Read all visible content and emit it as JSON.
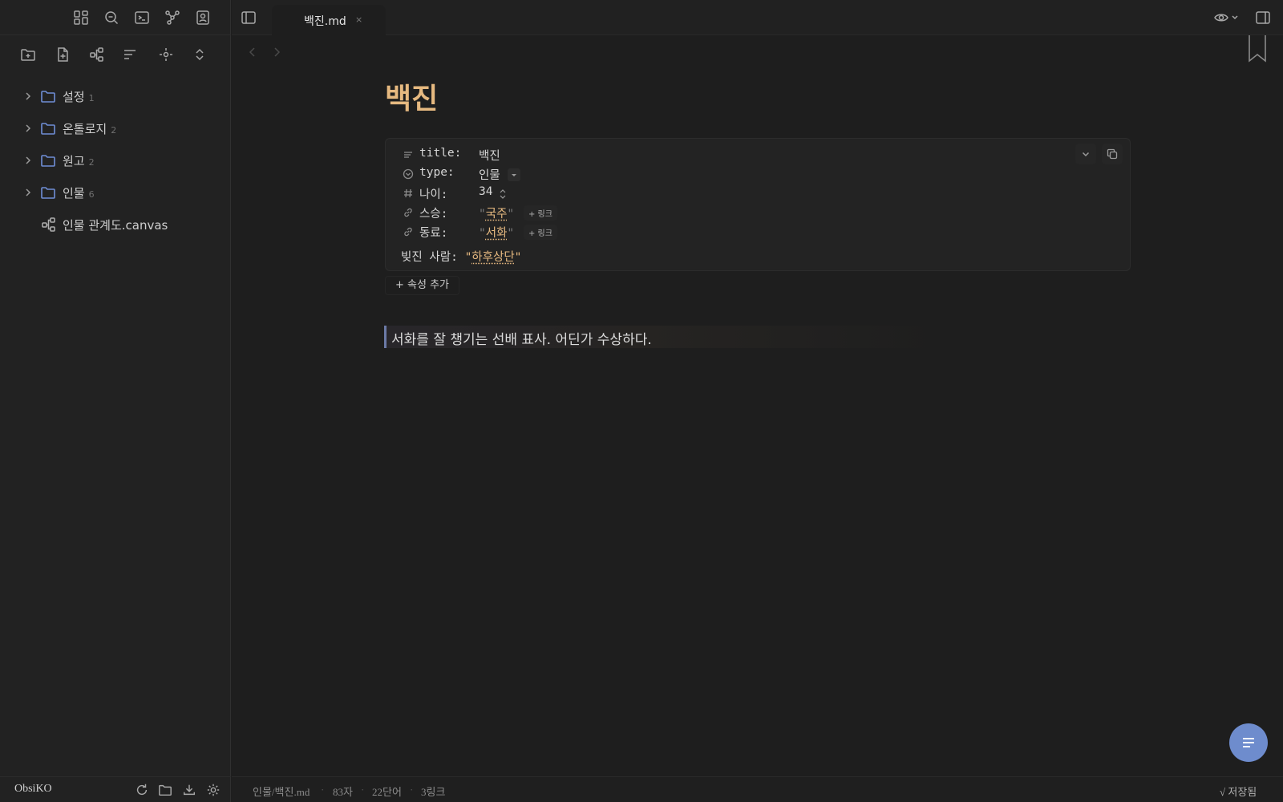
{
  "sidebar": {
    "ribbon_icons": [
      "dashboard-icon",
      "search-icon",
      "terminal-icon",
      "graph-icon",
      "contact-icon"
    ],
    "toolbar_icons": [
      "new-folder-icon",
      "new-note-icon",
      "new-canvas-icon",
      "sort-icon",
      "reveal-icon",
      "collapse-icon"
    ],
    "tree": [
      {
        "name": "설정",
        "count": "1",
        "type": "folder"
      },
      {
        "name": "온톨로지",
        "count": "2",
        "type": "folder"
      },
      {
        "name": "원고",
        "count": "2",
        "type": "folder"
      },
      {
        "name": "인물",
        "count": "6",
        "type": "folder"
      },
      {
        "name": "인물 관계도.canvas",
        "type": "canvas"
      }
    ],
    "vault_name": "ObsiKO"
  },
  "tabbar": {
    "tab_title": "백진.md",
    "tab_close": "×"
  },
  "note": {
    "title": "백진",
    "properties": {
      "title": {
        "key": "title:",
        "value": "백진"
      },
      "type": {
        "key": "type:",
        "value": "인물"
      },
      "age": {
        "key": "나이:",
        "value": "34"
      },
      "mentor": {
        "key": "스승:",
        "open_quote": "\"",
        "value": "국주",
        "close_quote": "\"",
        "add_link": "+ 링크"
      },
      "colleague": {
        "key": "동료:",
        "open_quote": "\"",
        "value": "서화",
        "close_quote": "\"",
        "add_link": "+ 링크"
      },
      "debtor": {
        "key": "빚진 사람:",
        "open_quote": "\"",
        "value": "하후상단",
        "close_quote": "\""
      }
    },
    "add_property": "+ 속성 추가",
    "body": "서화를 잘 챙기는 선배 표사. 어딘가 수상하다."
  },
  "status": {
    "path": "인물/백진.md",
    "chars": "83자",
    "words": "22단어",
    "links": "3링크",
    "saved": "√ 저장됨",
    "separator": "·"
  },
  "colors": {
    "accent": "#e6b980",
    "folder": "#6f8ed6",
    "fab": "#6e8ccd"
  }
}
